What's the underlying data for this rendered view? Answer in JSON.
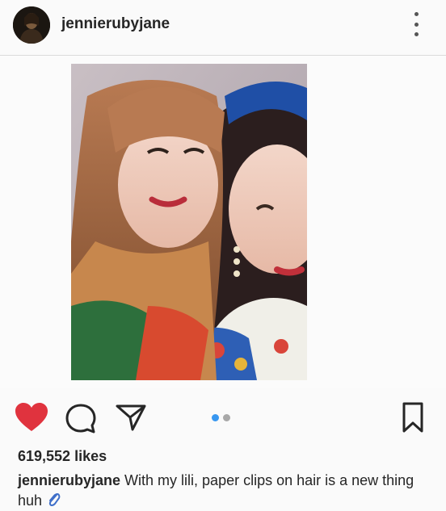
{
  "post": {
    "username": "jennierubyjane",
    "likes": "619,552 likes",
    "caption": {
      "username": "jennierubyjane",
      "text": " With my lili, paper clips on hair is a new thing huh"
    }
  },
  "carousel": {
    "current": 1,
    "total": 2
  },
  "icons": {
    "heart": "heart-icon",
    "comment": "comment-icon",
    "share": "share-icon",
    "bookmark": "bookmark-icon",
    "more": "more-options-icon",
    "clip": "paperclip-emoji"
  },
  "colors": {
    "like": "#e0333e",
    "carousel_active": "#3897f0",
    "carousel_inactive": "#a8a8a8"
  }
}
